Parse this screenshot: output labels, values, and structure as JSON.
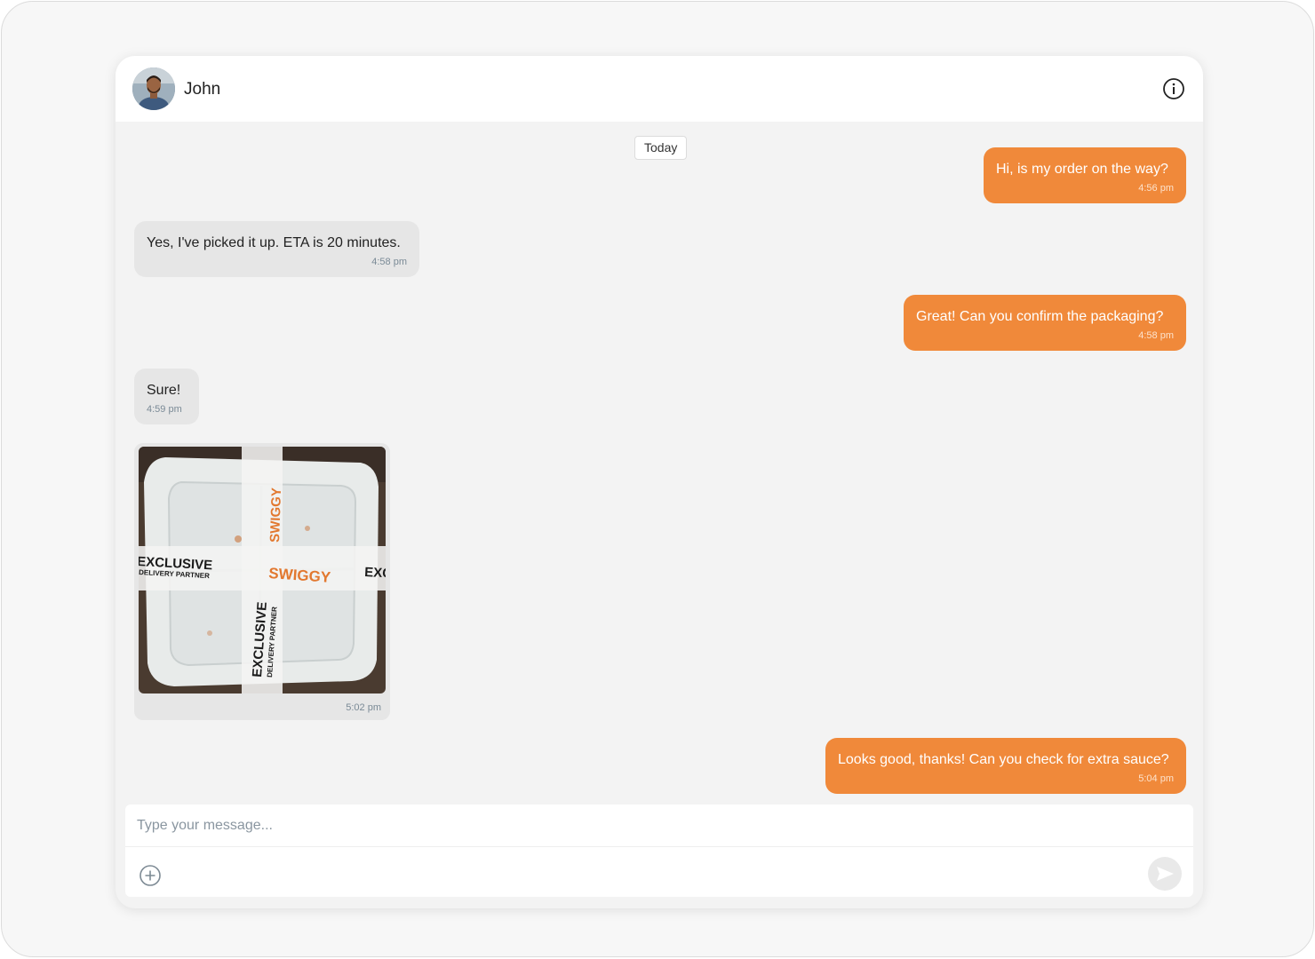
{
  "contact": {
    "name": "John",
    "avatar_icon": "person-avatar"
  },
  "header": {
    "info_icon": "info-circle-icon"
  },
  "day_divider": "Today",
  "messages": [
    {
      "direction": "outgoing",
      "text": "Hi, is my order on the way?",
      "time": "4:56 pm"
    },
    {
      "direction": "incoming",
      "text": "Yes, I've picked it up. ETA is 20 minutes.",
      "time": "4:58 pm"
    },
    {
      "direction": "outgoing",
      "text": "Great! Can you confirm the packaging?",
      "time": "4:58 pm"
    },
    {
      "direction": "incoming",
      "text": "Sure!",
      "time": "4:59 pm"
    },
    {
      "direction": "incoming",
      "type": "image",
      "time": "5:02 pm",
      "image": {
        "tape_brand": "SWIGGY",
        "tape_line1": "EXCLUSIVE",
        "tape_line2": "DELIVERY PARTNER"
      }
    },
    {
      "direction": "outgoing",
      "text": "Looks good, thanks! Can you check for extra sauce?",
      "time": "5:04 pm"
    }
  ],
  "composer": {
    "placeholder": "Type your message...",
    "attach_icon": "plus-circle-icon",
    "send_icon": "send-icon"
  },
  "colors": {
    "outgoing_bubble": "#f0893a",
    "incoming_bubble": "#e6e6e6",
    "chat_background": "#f3f3f3"
  }
}
